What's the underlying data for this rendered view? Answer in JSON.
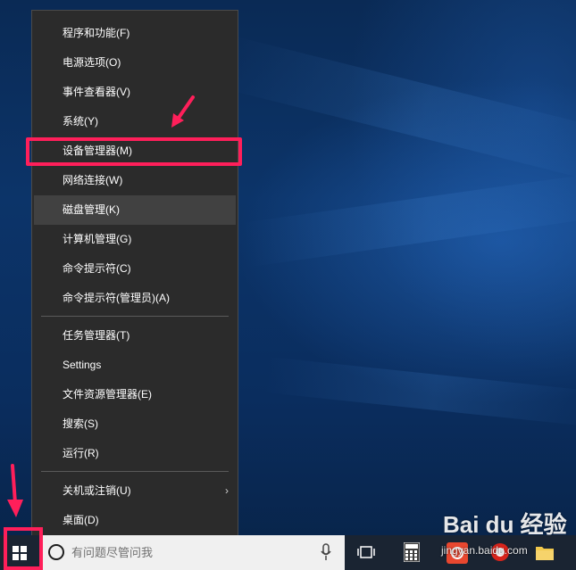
{
  "context_menu": {
    "items": [
      {
        "label": "程序和功能(F)"
      },
      {
        "label": "电源选项(O)"
      },
      {
        "label": "事件查看器(V)"
      },
      {
        "label": "系统(Y)"
      },
      {
        "label": "设备管理器(M)"
      },
      {
        "label": "网络连接(W)"
      },
      {
        "label": "磁盘管理(K)"
      },
      {
        "label": "计算机管理(G)"
      },
      {
        "label": "命令提示符(C)"
      },
      {
        "label": "命令提示符(管理员)(A)"
      },
      {
        "label": "任务管理器(T)"
      },
      {
        "label": "Settings"
      },
      {
        "label": "文件资源管理器(E)"
      },
      {
        "label": "搜索(S)"
      },
      {
        "label": "运行(R)"
      },
      {
        "label": "关机或注销(U)"
      },
      {
        "label": "桌面(D)"
      }
    ],
    "hovered_item": "磁盘管理(K)",
    "highlighted_item": "设备管理器(M)",
    "submenu_arrow": "›"
  },
  "taskbar": {
    "search_placeholder": "有问题尽管问我",
    "icons": [
      "windows-logo-icon",
      "cortana-icon",
      "microphone-icon",
      "task-view-icon",
      "calculator-icon",
      "red-app-icon",
      "red-circle-app-icon",
      "file-explorer-icon"
    ]
  },
  "watermark": {
    "logo": "Bai du 经验",
    "url": "jingyan.baidu.com"
  },
  "colors": {
    "annotation": "#ff1f5a",
    "menu_bg": "#2b2b2b",
    "menu_hover": "#414141",
    "taskbar": "#1a2432",
    "desktop": "#0c3469"
  }
}
